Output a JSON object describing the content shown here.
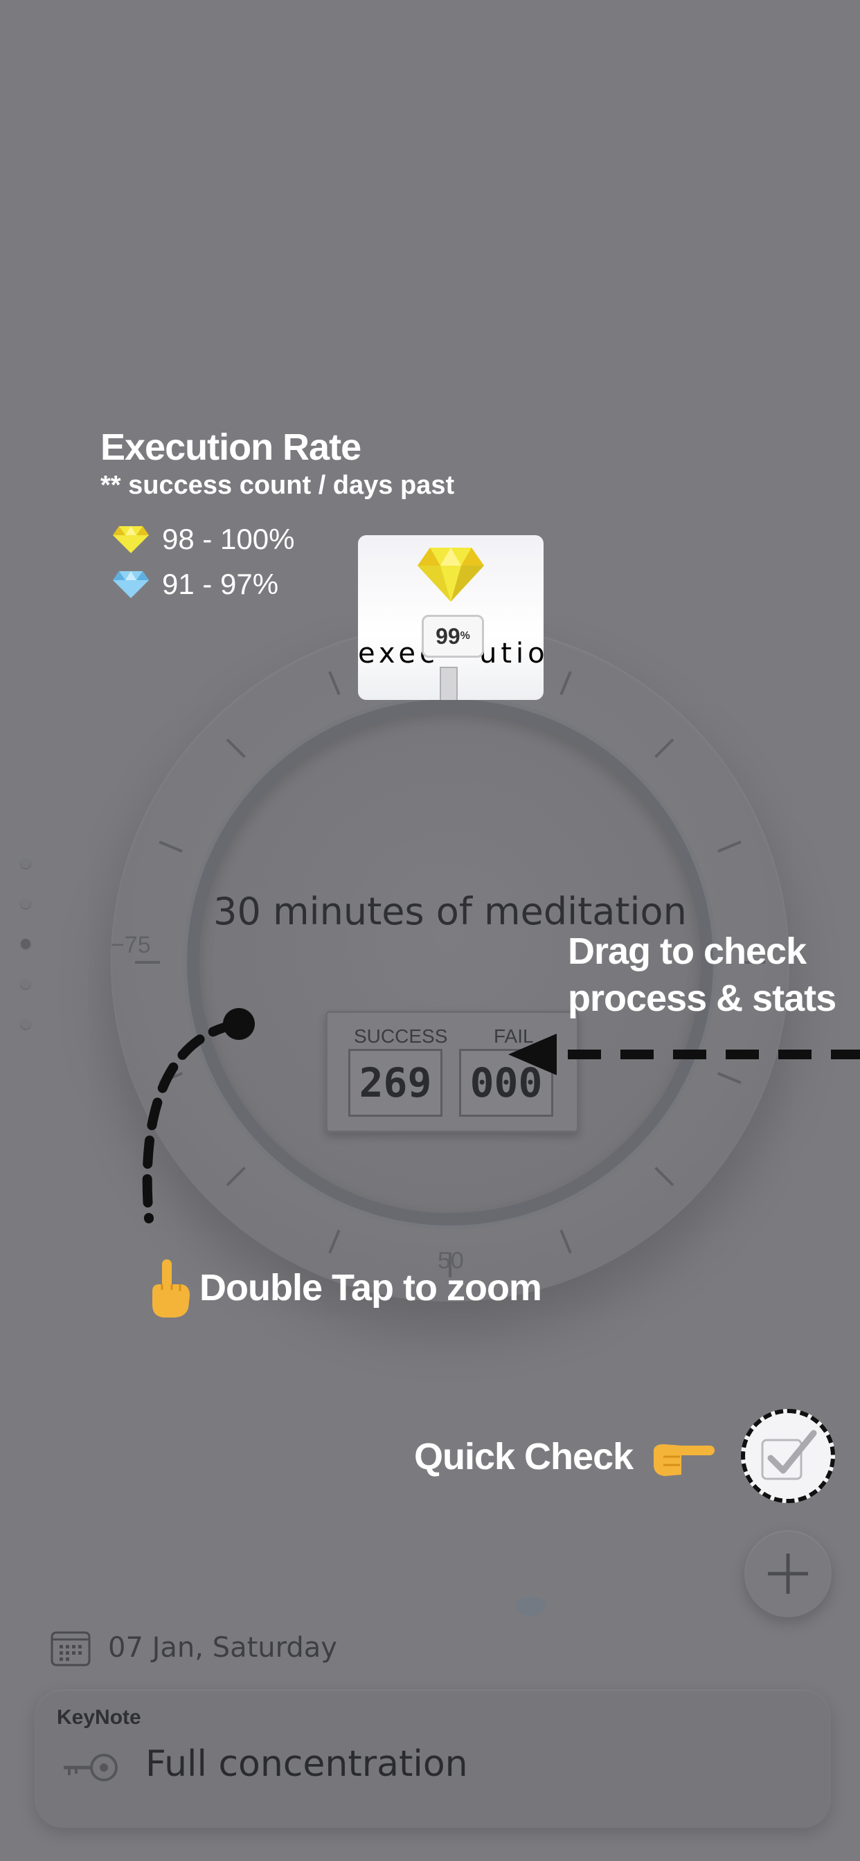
{
  "tutorial": {
    "title": "Execution Rate",
    "subtitle": "** success count / days past",
    "legend": [
      {
        "range": "98 - 100%",
        "icon": "yellow-diamond-icon",
        "color": "#f2e84a"
      },
      {
        "range": "91 - 97%",
        "icon": "blue-diamond-icon",
        "color": "#7cc8ef"
      }
    ]
  },
  "highlight": {
    "percent": "99",
    "percent_sign": "%",
    "arc_left": "exec",
    "arc_right": "ution"
  },
  "dial": {
    "label_left": "75",
    "label_bottom": "50",
    "habit_title": "30 minutes of meditation",
    "success_label": "SUCCESS",
    "fail_label": "FAIL",
    "success_value": "269",
    "fail_value": "000"
  },
  "callouts": {
    "drag_line1": "Drag to check",
    "drag_line2": "process & stats",
    "double_tap": "Double Tap to zoom",
    "quick_check": "Quick Check"
  },
  "bottom": {
    "date": "07 Jan, Saturday",
    "keynote_label": "KeyNote",
    "keynote_text": "Full concentration"
  },
  "colors": {
    "background": "#7b7b7f",
    "overlay_text": "#ffffff",
    "gem_yellow": "#f2e84a",
    "gem_blue": "#7cc8ef"
  }
}
